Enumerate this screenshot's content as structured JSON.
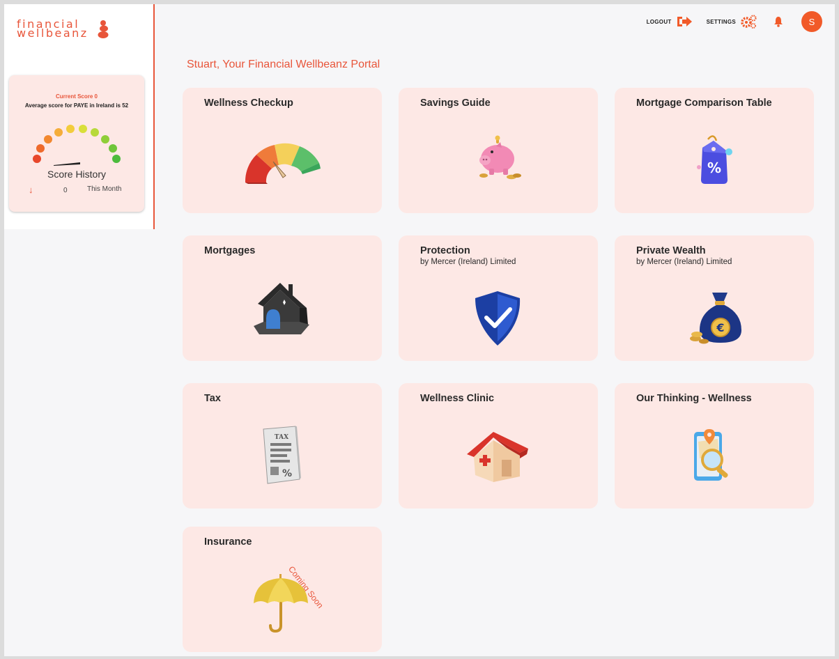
{
  "brand": {
    "line1": "financial",
    "line2": "wellbeanz"
  },
  "score": {
    "current_label": "Current Score 0",
    "average_label": "Average score for PAYE in Ireland is 52",
    "history_label": "Score History",
    "change_value": "0",
    "period_label": "This Month"
  },
  "header": {
    "logout_label": "LOGOUT",
    "settings_label": "SETTINGS",
    "avatar_initial": "S"
  },
  "welcome": "Stuart, Your Financial Wellbeanz Portal",
  "cards": [
    {
      "title": "Wellness Checkup",
      "icon": "gauge-icon"
    },
    {
      "title": "Savings Guide",
      "icon": "piggy-bank-icon"
    },
    {
      "title": "Mortgage Comparison Table",
      "icon": "percent-tag-icon"
    },
    {
      "title": "Mortgages",
      "icon": "house-icon"
    },
    {
      "title": "Protection",
      "subtitle": "by Mercer (Ireland) Limited",
      "icon": "shield-check-icon"
    },
    {
      "title": "Private Wealth",
      "subtitle": "by Mercer (Ireland) Limited",
      "icon": "money-bag-icon"
    },
    {
      "title": "Tax",
      "icon": "tax-document-icon"
    },
    {
      "title": "Wellness Clinic",
      "icon": "clinic-icon"
    },
    {
      "title": "Our Thinking - Wellness",
      "icon": "map-search-icon"
    },
    {
      "title": "Insurance",
      "icon": "umbrella-icon",
      "badge": "Coming Soon"
    }
  ],
  "colors": {
    "accent": "#e8553a",
    "card_bg": "#fde8e5",
    "page_bg": "#f6f6f8"
  }
}
